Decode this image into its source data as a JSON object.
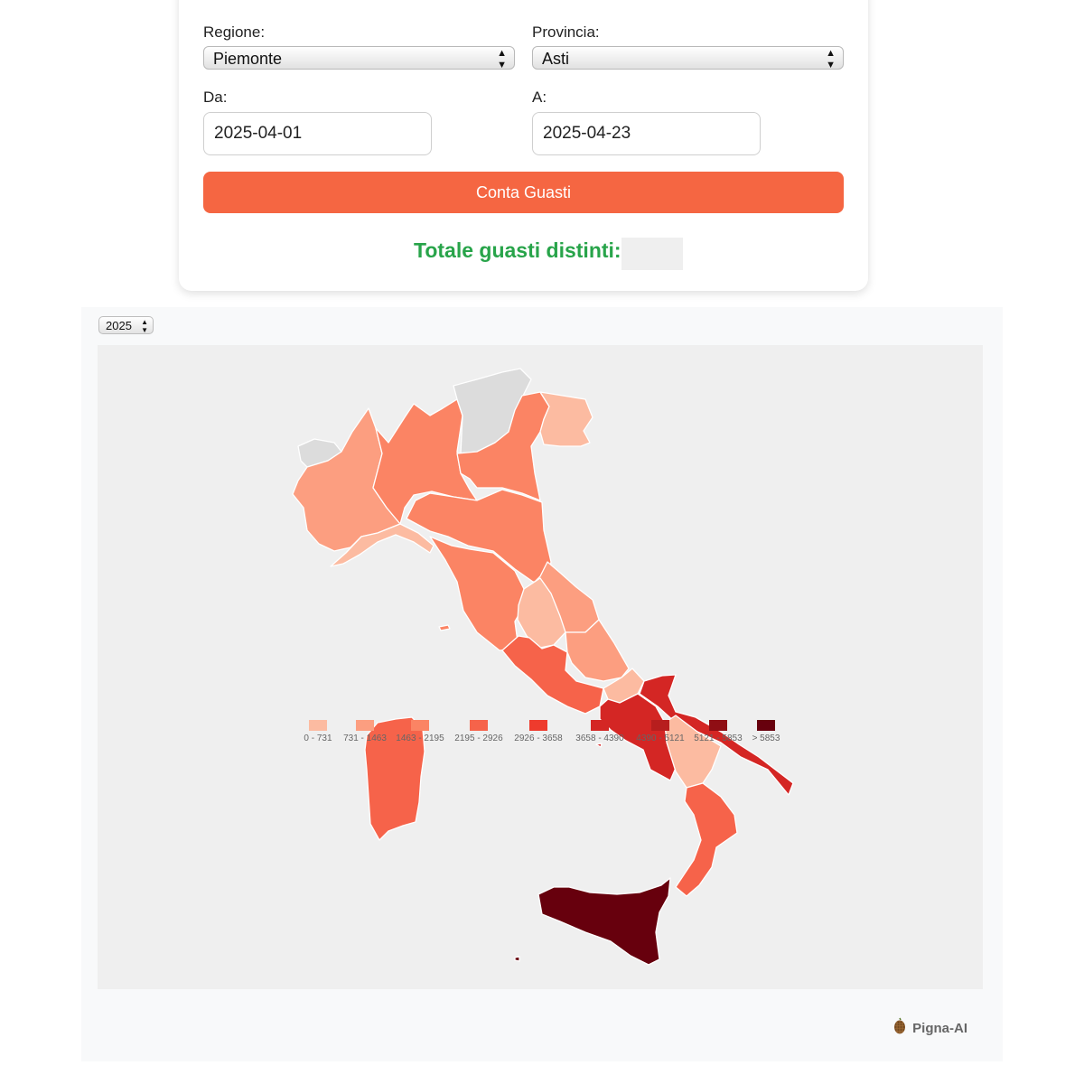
{
  "form": {
    "region_label": "Regione:",
    "region_value": "Piemonte",
    "province_label": "Provincia:",
    "province_value": "Asti",
    "from_label": "Da:",
    "from_value": "2025-04-01",
    "to_label": "A:",
    "to_value": "2025-04-23",
    "button_label": "Conta Guasti",
    "total_label": "Totale guasti distinti:"
  },
  "map": {
    "year_value": "2025",
    "legend": [
      {
        "label": "0 - 731",
        "color": "#fcbba1"
      },
      {
        "label": "731 - 1463",
        "color": "#fc9e80"
      },
      {
        "label": "1463 - 2195",
        "color": "#fb8464"
      },
      {
        "label": "2195 - 2926",
        "color": "#f6634a"
      },
      {
        "label": "2926 - 3658",
        "color": "#ee3b2d"
      },
      {
        "label": "3658 - 4390",
        "color": "#d42624"
      },
      {
        "label": "4390 - 5121",
        "color": "#b71e1e"
      },
      {
        "label": "5121 - 5853",
        "color": "#8f0e14"
      },
      {
        "label": "> 5853",
        "color": "#67000d"
      }
    ],
    "no_data_color": "#dcdcdc"
  },
  "brand": {
    "name": "Pigna-AI",
    "icon": "pinecone-icon"
  }
}
